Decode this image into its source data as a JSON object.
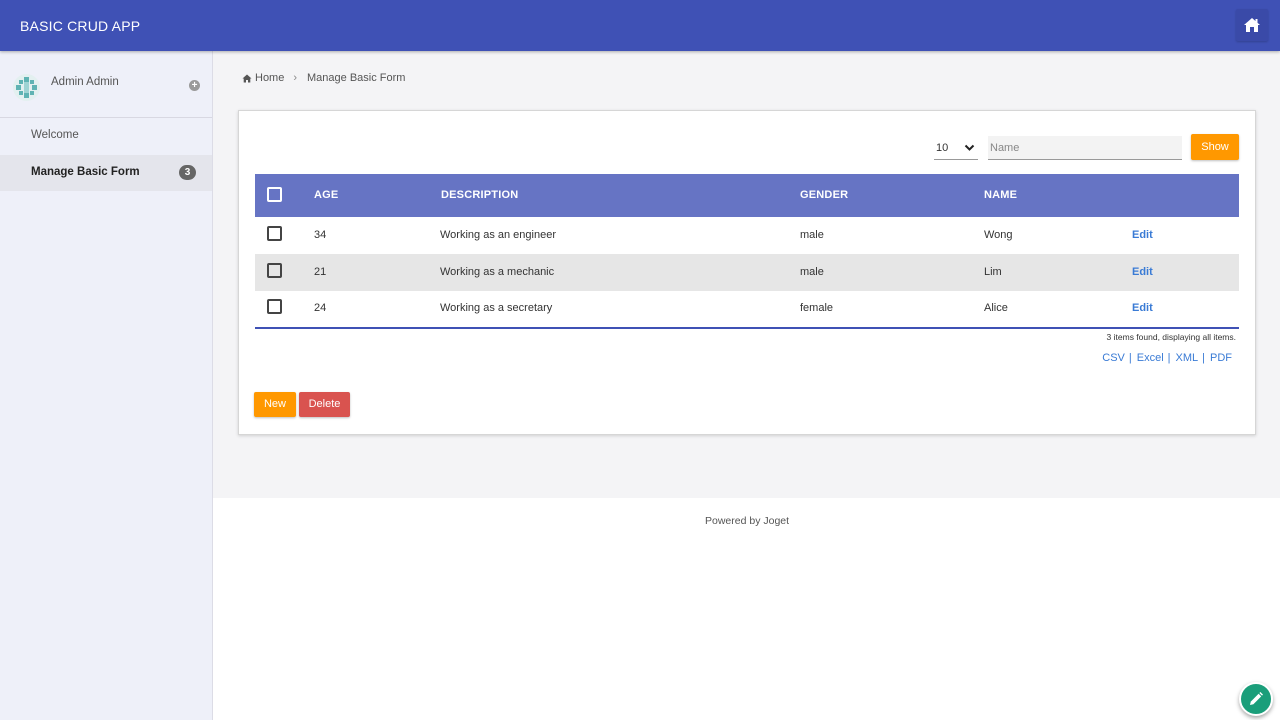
{
  "header": {
    "app_title": "BASIC CRUD APP",
    "home_icon": "home-icon",
    "bg_color": "#3f51b5"
  },
  "sidebar": {
    "user_name": "Admin Admin",
    "items": [
      {
        "label": "Welcome",
        "active": false
      },
      {
        "label": "Manage Basic Form",
        "active": true,
        "badge": "3"
      }
    ]
  },
  "breadcrumb": {
    "home": "Home",
    "current": "Manage Basic Form"
  },
  "filter": {
    "page_size": "10",
    "name_placeholder": "Name",
    "show_label": "Show"
  },
  "table": {
    "columns": [
      "AGE",
      "DESCRIPTION",
      "GENDER",
      "NAME"
    ],
    "rows": [
      {
        "age": "34",
        "description": "Working as an engineer",
        "gender": "male",
        "name": "Wong",
        "action": "Edit"
      },
      {
        "age": "21",
        "description": "Working as a mechanic",
        "gender": "male",
        "name": "Lim",
        "action": "Edit"
      },
      {
        "age": "24",
        "description": "Working as a secretary",
        "gender": "female",
        "name": "Alice",
        "action": "Edit"
      }
    ],
    "count_text": "3 items found, displaying all items.",
    "exports": [
      "CSV",
      "Excel",
      "XML",
      "PDF"
    ],
    "header_color": "#6674c4"
  },
  "actions": {
    "new_label": "New",
    "delete_label": "Delete"
  },
  "footer": {
    "text": "Powered by Joget"
  },
  "fab": {
    "icon": "pencil-icon",
    "color": "#1a9e7a"
  }
}
